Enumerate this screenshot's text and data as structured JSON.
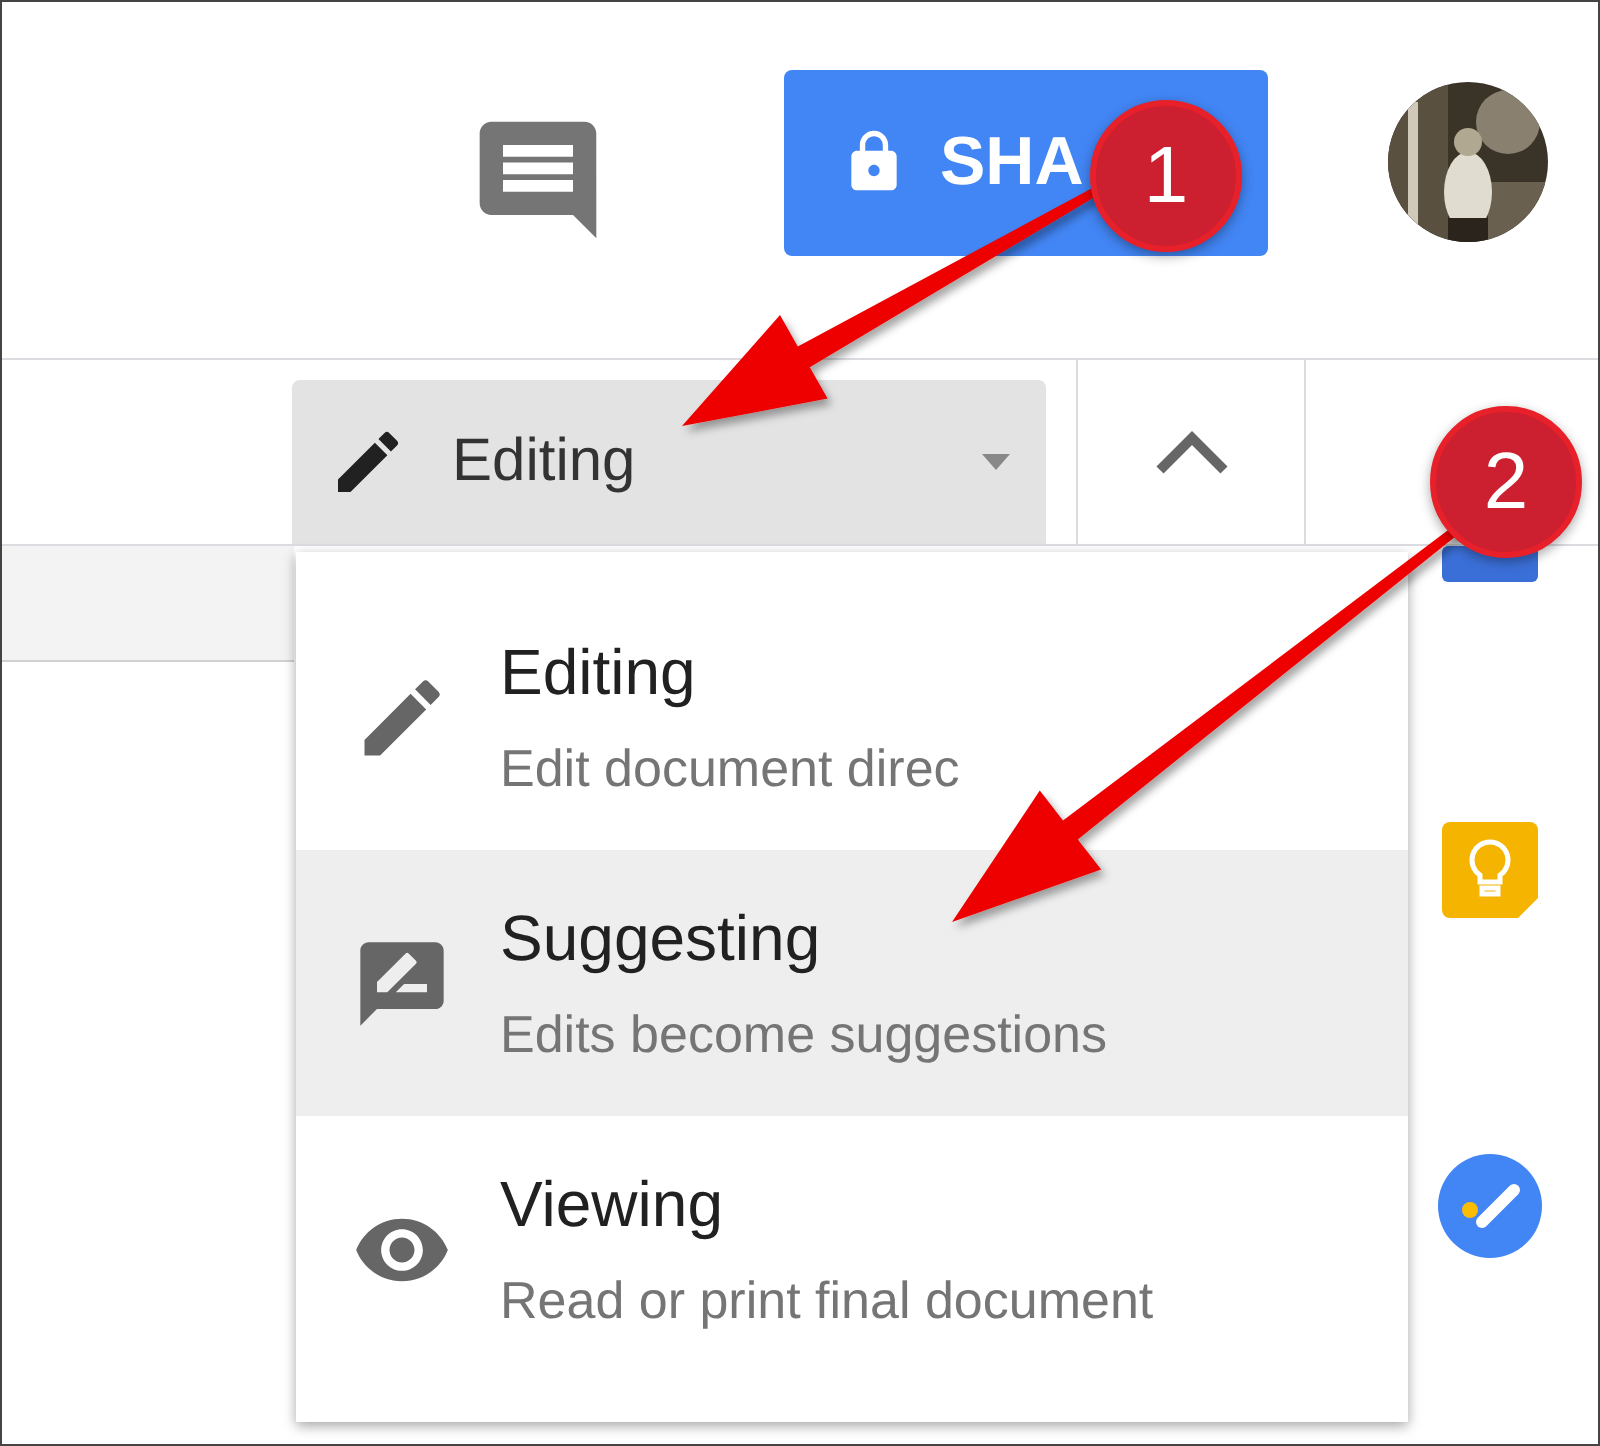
{
  "header": {
    "share_button": {
      "label": "SHA"
    }
  },
  "toolbar": {
    "mode_button": {
      "label": "Editing"
    }
  },
  "mode_menu": {
    "items": [
      {
        "kind": "pencil",
        "title": "Editing",
        "description": "Edit document direc",
        "selected": false
      },
      {
        "kind": "suggest",
        "title": "Suggesting",
        "description": "Edits become suggestions",
        "selected": true
      },
      {
        "kind": "eye",
        "title": "Viewing",
        "description": "Read or print final document",
        "selected": false
      }
    ]
  },
  "annotations": [
    {
      "label": "1"
    },
    {
      "label": "2"
    }
  ]
}
